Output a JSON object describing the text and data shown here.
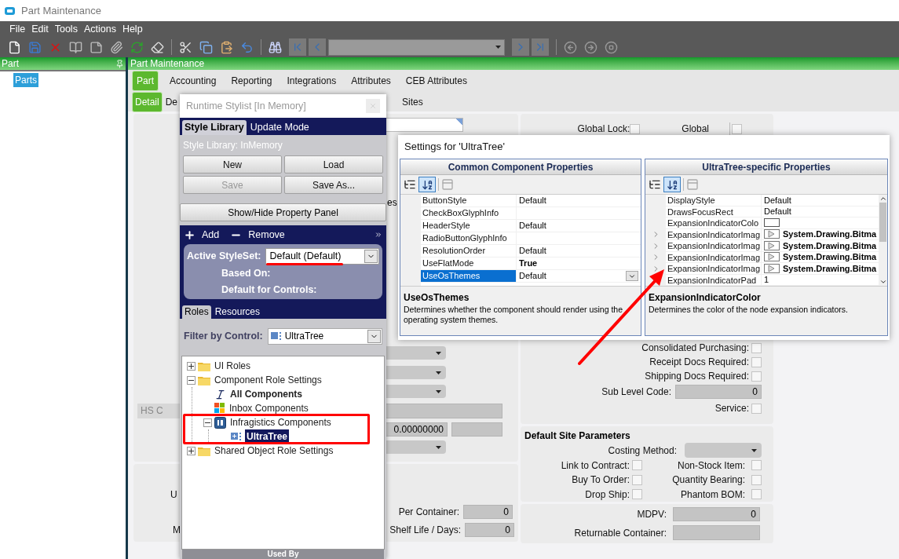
{
  "window": {
    "title": "Part Maintenance"
  },
  "menu": [
    "File",
    "Edit",
    "Tools",
    "Actions",
    "Help"
  ],
  "left_panel": {
    "title": "Part",
    "items": [
      {
        "label": "Parts",
        "selected": true
      }
    ]
  },
  "main": {
    "title": "Part Maintenance",
    "tabs": [
      {
        "label": "Part",
        "selected": true
      },
      {
        "label": "Accounting",
        "selected": false
      },
      {
        "label": "Reporting",
        "selected": false
      },
      {
        "label": "Integrations",
        "selected": false
      },
      {
        "label": "Attributes",
        "selected": false
      },
      {
        "label": "CEB Attributes",
        "selected": false
      }
    ],
    "subtabs": [
      {
        "label": "Detail",
        "selected": true
      },
      {
        "label": "De",
        "selected": false
      },
      {
        "label": "Sites",
        "selected": false
      }
    ],
    "left_form": {
      "label_fragment": "es",
      "hs_button": "HS C",
      "rate_value": "0.00000000",
      "lower_fragment_1": "U",
      "lower_fragment_2": "M",
      "per_container": {
        "label": "Per Container:",
        "value": "0"
      },
      "shelf_life": {
        "label": "Shelf Life / Days:",
        "value": "0"
      }
    },
    "right_form": {
      "global_lock": {
        "label": "Global Lock:",
        "checked": false
      },
      "global": {
        "label": "Global",
        "checked": false
      },
      "checks": [
        {
          "label": "Consolidated Purchasing:",
          "checked": false
        },
        {
          "label": "Receipt Docs Required:",
          "checked": false
        },
        {
          "label": "Shipping Docs Required:",
          "checked": false
        }
      ],
      "sub_level_code": {
        "label": "Sub Level Code:",
        "value": "0"
      },
      "service": {
        "label": "Service:",
        "checked": false
      },
      "site_parameters": {
        "title": "Default Site Parameters",
        "costing_method": "Costing Method:",
        "checks": [
          {
            "label": "Link to Contract:",
            "checked": false
          },
          {
            "label": "Non-Stock Item:",
            "checked": false
          },
          {
            "label": "Buy To Order:",
            "checked": false
          },
          {
            "label": "Quantity Bearing:",
            "checked": false
          },
          {
            "label": "Drop Ship:",
            "checked": false
          },
          {
            "label": "Phantom BOM:",
            "checked": false
          }
        ]
      },
      "mdpv": {
        "label": "MDPV:",
        "value": "0"
      },
      "returnable_container": {
        "label": "Returnable Container:"
      }
    }
  },
  "stylist": {
    "title": "Runtime Stylist [In Memory]",
    "tabs": [
      {
        "label": "Style Library",
        "selected": true
      },
      {
        "label": "Update Mode",
        "selected": false
      }
    ],
    "library": "Style Library: InMemory",
    "buttons": [
      {
        "label": "New",
        "disabled": false
      },
      {
        "label": "Load",
        "disabled": false
      },
      {
        "label": "Save",
        "disabled": true
      },
      {
        "label": "Save As...",
        "disabled": false
      }
    ],
    "panel_button": "Show/Hide Property Panel",
    "add": "Add",
    "remove": "Remove",
    "active_styleset": {
      "label": "Active StyleSet:",
      "value": "Default (Default)"
    },
    "based_on": "Based On:",
    "default_for_controls": "Default for Controls:",
    "bottom_tabs": [
      {
        "label": "Roles",
        "selected": true
      },
      {
        "label": "Resources",
        "selected": false
      }
    ],
    "filter": {
      "label": "Filter by Control:",
      "value": "UltraTree"
    },
    "tree": [
      {
        "label": "UI Roles",
        "kind": "folder",
        "expanded": false
      },
      {
        "label": "Component Role Settings",
        "kind": "folder",
        "expanded": true,
        "children": [
          {
            "label": "All Components",
            "kind": "font",
            "bold": true
          },
          {
            "label": "Inbox Components",
            "kind": "windows",
            "bold": false
          },
          {
            "label": "Infragistics Components",
            "kind": "library",
            "expanded": true,
            "children": [
              {
                "label": "UltraTree",
                "kind": "control",
                "bold": true,
                "selected": true
              }
            ]
          }
        ]
      },
      {
        "label": "Shared Object Role Settings",
        "kind": "folder",
        "expanded": false
      }
    ],
    "footer": "Used By"
  },
  "settings": {
    "title": "Settings for 'UltraTree'",
    "panes": [
      {
        "title": "Common Component Properties",
        "rows": [
          {
            "name": "ButtonStyle",
            "value": "Default",
            "kind": "text",
            "bold": false,
            "selected": false
          },
          {
            "name": "CheckBoxGlyphInfo",
            "kind": "empty",
            "selected": false
          },
          {
            "name": "HeaderStyle",
            "value": "Default",
            "kind": "text",
            "bold": false,
            "selected": false
          },
          {
            "name": "RadioButtonGlyphInfo",
            "kind": "empty",
            "selected": false
          },
          {
            "name": "ResolutionOrder",
            "value": "Default",
            "kind": "text",
            "bold": false,
            "selected": false
          },
          {
            "name": "UseFlatMode",
            "value": "True",
            "kind": "text",
            "bold": true,
            "selected": false
          },
          {
            "name": "UseOsThemes",
            "value": "Default",
            "kind": "text",
            "bold": false,
            "selected": true
          }
        ],
        "description": {
          "title": "UseOsThemes",
          "text": "Determines whether the component should render using the operating system themes."
        }
      },
      {
        "title": "UltraTree-specific Properties",
        "rows": [
          {
            "name": "DisplayStyle",
            "value": "Default",
            "kind": "text",
            "bold": false,
            "selected": false
          },
          {
            "name": "DrawsFocusRect",
            "value": "Default",
            "kind": "text",
            "bold": false,
            "selected": false
          },
          {
            "name": "ExpansionIndicatorColo",
            "kind": "color",
            "selected": false
          },
          {
            "name": "ExpansionIndicatorImag",
            "value": "System.Drawing.Bitma",
            "kind": "image",
            "bold": true,
            "expandable": true,
            "selected": false
          },
          {
            "name": "ExpansionIndicatorImag",
            "value": "System.Drawing.Bitma",
            "kind": "image",
            "bold": true,
            "expandable": true,
            "selected": false
          },
          {
            "name": "ExpansionIndicatorImag",
            "value": "System.Drawing.Bitma",
            "kind": "image",
            "bold": true,
            "expandable": true,
            "selected": false
          },
          {
            "name": "ExpansionIndicatorImag",
            "value": "System.Drawing.Bitma",
            "kind": "image",
            "bold": true,
            "expandable": true,
            "selected": false
          },
          {
            "name": "ExpansionIndicatorPad",
            "value": "1",
            "kind": "text",
            "bold": false,
            "selected": false
          }
        ],
        "description": {
          "title": "ExpansionIndicatorColor",
          "text": "Determines the color of the node expansion indicators."
        }
      }
    ]
  }
}
